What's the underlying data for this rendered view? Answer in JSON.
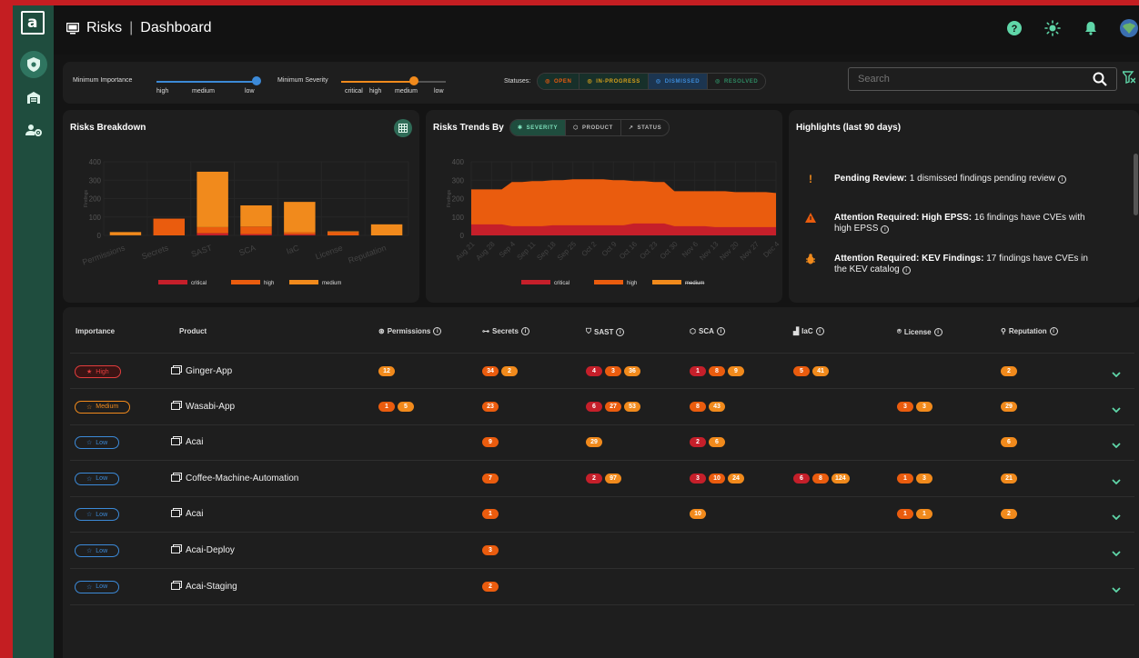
{
  "header": {
    "section": "Risks",
    "page": "Dashboard"
  },
  "filters": {
    "min_importance": {
      "label": "Minimum Importance",
      "ticks": [
        "high",
        "medium",
        "low"
      ],
      "value": "low"
    },
    "min_severity": {
      "label": "Minimum Severity",
      "ticks": [
        "critical",
        "high",
        "medium",
        "low"
      ],
      "value": "medium"
    },
    "statuses": {
      "label": "Statuses:",
      "items": [
        {
          "label": "OPEN",
          "color": "#ea5c0e",
          "icon": "warning-circle-icon"
        },
        {
          "label": "IN-PROGRESS",
          "color": "#d6a01b",
          "icon": "clock-icon"
        },
        {
          "label": "DISMISSED",
          "color": "#3c8ad8",
          "icon": "minus-circle-icon"
        },
        {
          "label": "RESOLVED",
          "color": "#2e8a63",
          "icon": "check-circle-icon"
        }
      ]
    },
    "search_placeholder": "Search"
  },
  "breakdown": {
    "title": "Risks Breakdown",
    "chart_data": {
      "type": "bar",
      "stacked": true,
      "ylim": [
        0,
        400
      ],
      "yticks": [
        0,
        100,
        200,
        300,
        400
      ],
      "ylabel": "Findings",
      "categories": [
        "Permissions",
        "Secrets",
        "SAST",
        "SCA",
        "IaC",
        "License",
        "Reputation"
      ],
      "series": [
        {
          "name": "critical",
          "color": "#c51f2a",
          "values": [
            0,
            0,
            12,
            7,
            6,
            0,
            0
          ]
        },
        {
          "name": "high",
          "color": "#ea5c0e",
          "values": [
            1,
            91,
            33,
            41,
            11,
            18,
            0
          ]
        },
        {
          "name": "medium",
          "color": "#f18a1c",
          "values": [
            17,
            0,
            301,
            115,
            165,
            4,
            60
          ]
        }
      ],
      "legend": "bottom"
    }
  },
  "trends": {
    "title": "Risks Trends By",
    "tabs": [
      {
        "label": "SEVERITY",
        "icon": "bug-icon",
        "active": true
      },
      {
        "label": "PRODUCT",
        "icon": "cube-icon",
        "active": false
      },
      {
        "label": "STATUS",
        "icon": "trend-icon",
        "active": false
      }
    ],
    "chart_data": {
      "type": "area",
      "stacked": true,
      "ylim": [
        0,
        400
      ],
      "yticks": [
        0,
        100,
        200,
        300,
        400
      ],
      "ylabel": "Findings",
      "x": [
        "Aug 21",
        "Aug 28",
        "Sep 4",
        "Sep 11",
        "Sep 18",
        "Sep 25",
        "Oct 2",
        "Oct 9",
        "Oct 16",
        "Oct 23",
        "Oct 30",
        "Nov 6",
        "Nov 13",
        "Nov 20",
        "Nov 27",
        "Dec 4"
      ],
      "series": [
        {
          "name": "critical",
          "color": "#c51f2a",
          "values": [
            60,
            60,
            50,
            50,
            55,
            55,
            55,
            55,
            65,
            65,
            50,
            50,
            45,
            45,
            45,
            45
          ]
        },
        {
          "name": "high",
          "color": "#ea5c0e",
          "values": [
            190,
            190,
            240,
            245,
            245,
            250,
            250,
            245,
            230,
            225,
            190,
            190,
            195,
            190,
            190,
            185
          ]
        },
        {
          "name": "medium",
          "color": "#f18a1c",
          "values": [
            0,
            0,
            0,
            0,
            0,
            0,
            0,
            0,
            0,
            0,
            0,
            0,
            0,
            0,
            0,
            0
          ],
          "hidden": true
        }
      ],
      "legend": "bottom"
    }
  },
  "highlights": {
    "title": "Highlights (last 90 days)",
    "items": [
      {
        "icon": "exclamation-icon",
        "color": "#f18a1c",
        "bold": "Pending Review:",
        "text": " 1 dismissed findings pending review"
      },
      {
        "icon": "warning-triangle-icon",
        "color": "#ea5c0e",
        "bold": "Attention Required: High EPSS:",
        "text": " 16 findings have CVEs with high EPSS"
      },
      {
        "icon": "bug-icon",
        "color": "#f18a1c",
        "bold": "Attention Required: KEV Findings:",
        "text": " 17 findings have CVEs in the KEV catalog"
      }
    ]
  },
  "table": {
    "columns": [
      "Importance",
      "Product",
      "Permissions",
      "Secrets",
      "SAST",
      "SCA",
      "IaC",
      "License",
      "Reputation"
    ],
    "rows": [
      {
        "importance": "High",
        "imp_color": "#e23d3d",
        "product": "Ginger-App",
        "cells": [
          [
            [
              "m",
              "12"
            ]
          ],
          [
            [
              "h",
              "34"
            ],
            [
              "m",
              "2"
            ]
          ],
          [
            [
              "c",
              "4"
            ],
            [
              "h",
              "3"
            ],
            [
              "m",
              "36"
            ]
          ],
          [
            [
              "c",
              "1"
            ],
            [
              "h",
              "8"
            ],
            [
              "m",
              "9"
            ]
          ],
          [
            [
              "h",
              "5"
            ],
            [
              "m",
              "41"
            ]
          ],
          [],
          [
            [
              "m",
              "2"
            ]
          ]
        ]
      },
      {
        "importance": "Medium",
        "imp_color": "#f18a1c",
        "product": "Wasabi-App",
        "cells": [
          [
            [
              "h",
              "1"
            ],
            [
              "m",
              "5"
            ]
          ],
          [
            [
              "h",
              "23"
            ]
          ],
          [
            [
              "c",
              "6"
            ],
            [
              "h",
              "27"
            ],
            [
              "m",
              "53"
            ]
          ],
          [
            [
              "h",
              "8"
            ],
            [
              "m",
              "43"
            ]
          ],
          [],
          [
            [
              "h",
              "3"
            ],
            [
              "m",
              "3"
            ]
          ],
          [
            [
              "m",
              "29"
            ]
          ]
        ]
      },
      {
        "importance": "Low",
        "imp_color": "#3c8ad8",
        "product": "Acai",
        "cells": [
          [],
          [
            [
              "h",
              "9"
            ]
          ],
          [
            [
              "m",
              "29"
            ]
          ],
          [
            [
              "c",
              "2"
            ],
            [
              "m",
              "6"
            ]
          ],
          [],
          [],
          [
            [
              "m",
              "6"
            ]
          ]
        ]
      },
      {
        "importance": "Low",
        "imp_color": "#3c8ad8",
        "product": "Coffee-Machine-Automation",
        "cells": [
          [],
          [
            [
              "h",
              "7"
            ]
          ],
          [
            [
              "c",
              "2"
            ],
            [
              "m",
              "97"
            ]
          ],
          [
            [
              "c",
              "3"
            ],
            [
              "h",
              "10"
            ],
            [
              "m",
              "24"
            ]
          ],
          [
            [
              "c",
              "6"
            ],
            [
              "h",
              "8"
            ],
            [
              "m",
              "124"
            ]
          ],
          [
            [
              "h",
              "1"
            ],
            [
              "m",
              "3"
            ]
          ],
          [
            [
              "m",
              "21"
            ]
          ]
        ]
      },
      {
        "importance": "Low",
        "imp_color": "#3c8ad8",
        "product": "Acai",
        "cells": [
          [],
          [
            [
              "h",
              "1"
            ]
          ],
          [],
          [
            [
              "m",
              "10"
            ]
          ],
          [],
          [
            [
              "h",
              "1"
            ],
            [
              "m",
              "1"
            ]
          ],
          [
            [
              "m",
              "2"
            ]
          ]
        ]
      },
      {
        "importance": "Low",
        "imp_color": "#3c8ad8",
        "product": "Acai-Deploy",
        "cells": [
          [],
          [
            [
              "h",
              "3"
            ]
          ],
          [],
          [],
          [],
          [],
          []
        ]
      },
      {
        "importance": "Low",
        "imp_color": "#3c8ad8",
        "product": "Acai-Staging",
        "cells": [
          [],
          [
            [
              "h",
              "2"
            ]
          ],
          [],
          [],
          [],
          [],
          []
        ]
      }
    ]
  }
}
